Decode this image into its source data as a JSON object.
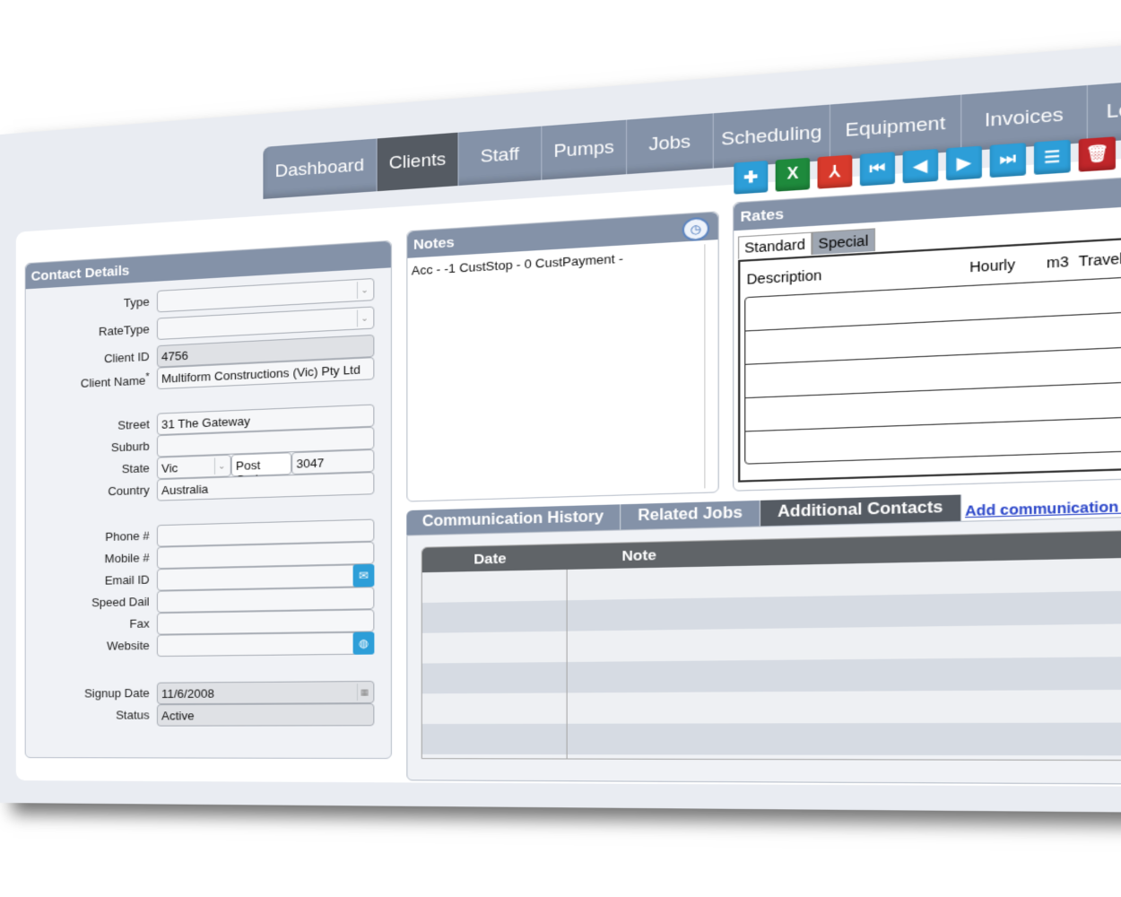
{
  "nav": {
    "tabs": [
      "Dashboard",
      "Clients",
      "Staff",
      "Pumps",
      "Jobs",
      "Scheduling",
      "Equipment",
      "Invoices",
      "Logout"
    ],
    "active": "Clients"
  },
  "toolbar": {
    "icons": [
      "add-icon",
      "excel-icon",
      "pdf-icon",
      "first-record-icon",
      "previous-record-icon",
      "next-record-icon",
      "last-record-icon",
      "list-icon",
      "delete-icon",
      "tools-icon"
    ]
  },
  "contact": {
    "title": "Contact Details",
    "labels": {
      "type": "Type",
      "ratetype": "RateType",
      "client_id": "Client ID",
      "client_name": "Client Name",
      "street": "Street",
      "suburb": "Suburb",
      "state": "State",
      "post_code": "Post Code",
      "country": "Country",
      "phone": "Phone #",
      "mobile": "Mobile #",
      "email": "Email ID",
      "speed_dial": "Speed Dail",
      "fax": "Fax",
      "website": "Website",
      "signup_date": "Signup Date",
      "status": "Status"
    },
    "required_mark": "*",
    "values": {
      "type": "",
      "ratetype": "",
      "client_id": "4756",
      "client_name": "Multiform Constructions (Vic) Pty Ltd",
      "street": "31 The Gateway",
      "suburb": "",
      "state": "Vic",
      "post_code": "3047",
      "country": "Australia",
      "phone": "",
      "mobile": "",
      "email": "",
      "speed_dial": "",
      "fax": "",
      "website": "",
      "signup_date": "11/6/2008",
      "status": "Active"
    }
  },
  "notes": {
    "title": "Notes",
    "text": "Acc -   -1  CustStop -   0  CustPayment -"
  },
  "rates": {
    "title": "Rates",
    "tabs": [
      "Standard",
      "Special"
    ],
    "columns": [
      "Description",
      "Hourly",
      "m3",
      "TravelTime"
    ]
  },
  "history": {
    "tabs": [
      "Communication History",
      "Related Jobs",
      "Additional Contacts"
    ],
    "active": "Additional Contacts",
    "add_link": "Add communication history",
    "columns": [
      "Date",
      "Note"
    ]
  },
  "colors": {
    "header": "#8492a8",
    "active_tab": "#555b63",
    "link": "#2a45c9"
  }
}
